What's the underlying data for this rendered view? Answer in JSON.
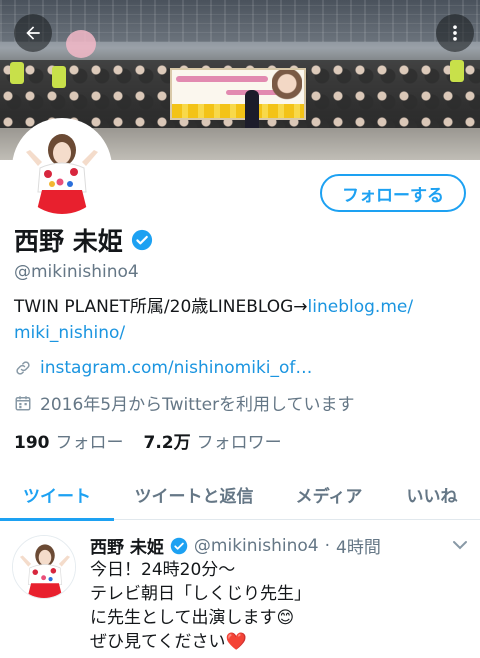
{
  "profile": {
    "name": "西野 未姫",
    "handle": "@mikinishino4",
    "follow_label": "フォローする",
    "bio_text": "TWIN PLANET所属/20歳LINEBLOG→",
    "bio_link_line1": "lineblog.me/",
    "bio_link_line2": "miki_nishino/",
    "website": "instagram.com/nishinomiki_of…",
    "joined": "2016年5月からTwitterを利用しています",
    "following_count": "190",
    "following_label": "フォロー",
    "followers_count": "7.2万",
    "followers_label": "フォロワー"
  },
  "tabs": [
    {
      "label": "ツイート",
      "active": true
    },
    {
      "label": "ツイートと返信",
      "active": false
    },
    {
      "label": "メディア",
      "active": false
    },
    {
      "label": "いいね",
      "active": false
    }
  ],
  "tweet": {
    "name": "西野 未姫",
    "handle": "@mikinishino4",
    "separator": "·",
    "time": "4時間",
    "lines": [
      "今日！24時20分〜",
      "テレビ朝日「しくじり先生」",
      "に先生として出演します😊",
      "ぜひ見てください❤️"
    ]
  },
  "icons": {
    "back": "arrow-left-icon",
    "more": "more-vertical-icon",
    "verified": "verified-badge-icon",
    "link": "link-icon",
    "calendar": "calendar-icon",
    "chevron": "chevron-down-icon"
  },
  "colors": {
    "accent": "#1da1f2",
    "link": "#1b95e0",
    "secondary_text": "#657786",
    "heart": "#e0245e"
  }
}
